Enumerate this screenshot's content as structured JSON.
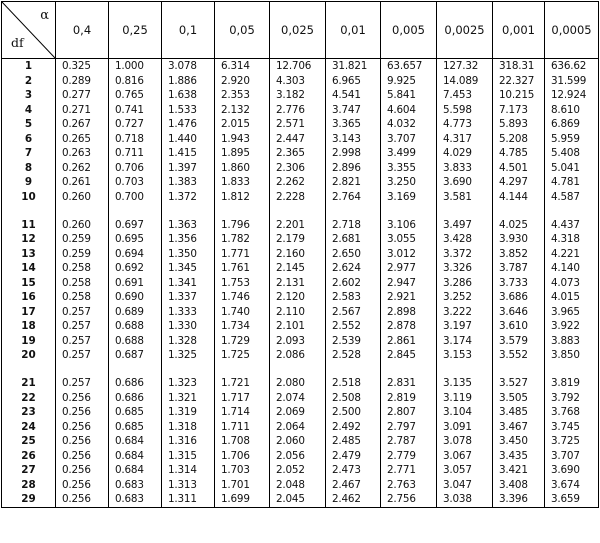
{
  "header": {
    "alpha_symbol": "α",
    "df_label": "df",
    "alphas": [
      "0,4",
      "0,25",
      "0,1",
      "0,05",
      "0,025",
      "0,01",
      "0,005",
      "0,0025",
      "0,001",
      "0,0005"
    ]
  },
  "groups": [
    {
      "rows": [
        {
          "df": "1",
          "values": [
            "0.325",
            "1.000",
            "3.078",
            "6.314",
            "12.706",
            "31.821",
            "63.657",
            "127.32",
            "318.31",
            "636.62"
          ]
        },
        {
          "df": "2",
          "values": [
            "0.289",
            "0.816",
            "1.886",
            "2.920",
            "4.303",
            "6.965",
            "9.925",
            "14.089",
            "22.327",
            "31.599"
          ]
        },
        {
          "df": "3",
          "values": [
            "0.277",
            "0.765",
            "1.638",
            "2.353",
            "3.182",
            "4.541",
            "5.841",
            "7.453",
            "10.215",
            "12.924"
          ]
        },
        {
          "df": "4",
          "values": [
            "0.271",
            "0.741",
            "1.533",
            "2.132",
            "2.776",
            "3.747",
            "4.604",
            "5.598",
            "7.173",
            "8.610"
          ]
        },
        {
          "df": "5",
          "values": [
            "0.267",
            "0.727",
            "1.476",
            "2.015",
            "2.571",
            "3.365",
            "4.032",
            "4.773",
            "5.893",
            "6.869"
          ]
        },
        {
          "df": "6",
          "values": [
            "0.265",
            "0.718",
            "1.440",
            "1.943",
            "2.447",
            "3.143",
            "3.707",
            "4.317",
            "5.208",
            "5.959"
          ]
        },
        {
          "df": "7",
          "values": [
            "0.263",
            "0.711",
            "1.415",
            "1.895",
            "2.365",
            "2.998",
            "3.499",
            "4.029",
            "4.785",
            "5.408"
          ]
        },
        {
          "df": "8",
          "values": [
            "0.262",
            "0.706",
            "1.397",
            "1.860",
            "2.306",
            "2.896",
            "3.355",
            "3.833",
            "4.501",
            "5.041"
          ]
        },
        {
          "df": "9",
          "values": [
            "0.261",
            "0.703",
            "1.383",
            "1.833",
            "2.262",
            "2.821",
            "3.250",
            "3.690",
            "4.297",
            "4.781"
          ]
        },
        {
          "df": "10",
          "values": [
            "0.260",
            "0.700",
            "1.372",
            "1.812",
            "2.228",
            "2.764",
            "3.169",
            "3.581",
            "4.144",
            "4.587"
          ]
        }
      ]
    },
    {
      "rows": [
        {
          "df": "11",
          "values": [
            "0.260",
            "0.697",
            "1.363",
            "1.796",
            "2.201",
            "2.718",
            "3.106",
            "3.497",
            "4.025",
            "4.437"
          ]
        },
        {
          "df": "12",
          "values": [
            "0.259",
            "0.695",
            "1.356",
            "1.782",
            "2.179",
            "2.681",
            "3.055",
            "3.428",
            "3.930",
            "4.318"
          ]
        },
        {
          "df": "13",
          "values": [
            "0.259",
            "0.694",
            "1.350",
            "1.771",
            "2.160",
            "2.650",
            "3.012",
            "3.372",
            "3.852",
            "4.221"
          ]
        },
        {
          "df": "14",
          "values": [
            "0.258",
            "0.692",
            "1.345",
            "1.761",
            "2.145",
            "2.624",
            "2.977",
            "3.326",
            "3.787",
            "4.140"
          ]
        },
        {
          "df": "15",
          "values": [
            "0.258",
            "0.691",
            "1.341",
            "1.753",
            "2.131",
            "2.602",
            "2.947",
            "3.286",
            "3.733",
            "4.073"
          ]
        },
        {
          "df": "16",
          "values": [
            "0.258",
            "0.690",
            "1.337",
            "1.746",
            "2.120",
            "2.583",
            "2.921",
            "3.252",
            "3.686",
            "4.015"
          ]
        },
        {
          "df": "17",
          "values": [
            "0.257",
            "0.689",
            "1.333",
            "1.740",
            "2.110",
            "2.567",
            "2.898",
            "3.222",
            "3.646",
            "3.965"
          ]
        },
        {
          "df": "18",
          "values": [
            "0.257",
            "0.688",
            "1.330",
            "1.734",
            "2.101",
            "2.552",
            "2.878",
            "3.197",
            "3.610",
            "3.922"
          ]
        },
        {
          "df": "19",
          "values": [
            "0.257",
            "0.688",
            "1.328",
            "1.729",
            "2.093",
            "2.539",
            "2.861",
            "3.174",
            "3.579",
            "3.883"
          ]
        },
        {
          "df": "20",
          "values": [
            "0.257",
            "0.687",
            "1.325",
            "1.725",
            "2.086",
            "2.528",
            "2.845",
            "3.153",
            "3.552",
            "3.850"
          ]
        }
      ]
    },
    {
      "rows": [
        {
          "df": "21",
          "values": [
            "0.257",
            "0.686",
            "1.323",
            "1.721",
            "2.080",
            "2.518",
            "2.831",
            "3.135",
            "3.527",
            "3.819"
          ]
        },
        {
          "df": "22",
          "values": [
            "0.256",
            "0.686",
            "1.321",
            "1.717",
            "2.074",
            "2.508",
            "2.819",
            "3.119",
            "3.505",
            "3.792"
          ]
        },
        {
          "df": "23",
          "values": [
            "0.256",
            "0.685",
            "1.319",
            "1.714",
            "2.069",
            "2.500",
            "2.807",
            "3.104",
            "3.485",
            "3.768"
          ]
        },
        {
          "df": "24",
          "values": [
            "0.256",
            "0.685",
            "1.318",
            "1.711",
            "2.064",
            "2.492",
            "2.797",
            "3.091",
            "3.467",
            "3.745"
          ]
        },
        {
          "df": "25",
          "values": [
            "0.256",
            "0.684",
            "1.316",
            "1.708",
            "2.060",
            "2.485",
            "2.787",
            "3.078",
            "3.450",
            "3.725"
          ]
        },
        {
          "df": "26",
          "values": [
            "0.256",
            "0.684",
            "1.315",
            "1.706",
            "2.056",
            "2.479",
            "2.779",
            "3.067",
            "3.435",
            "3.707"
          ]
        },
        {
          "df": "27",
          "values": [
            "0.256",
            "0.684",
            "1.314",
            "1.703",
            "2.052",
            "2.473",
            "2.771",
            "3.057",
            "3.421",
            "3.690"
          ]
        },
        {
          "df": "28",
          "values": [
            "0.256",
            "0.683",
            "1.313",
            "1.701",
            "2.048",
            "2.467",
            "2.763",
            "3.047",
            "3.408",
            "3.674"
          ]
        },
        {
          "df": "29",
          "values": [
            "0.256",
            "0.683",
            "1.311",
            "1.699",
            "2.045",
            "2.462",
            "2.756",
            "3.038",
            "3.396",
            "3.659"
          ]
        }
      ]
    }
  ]
}
